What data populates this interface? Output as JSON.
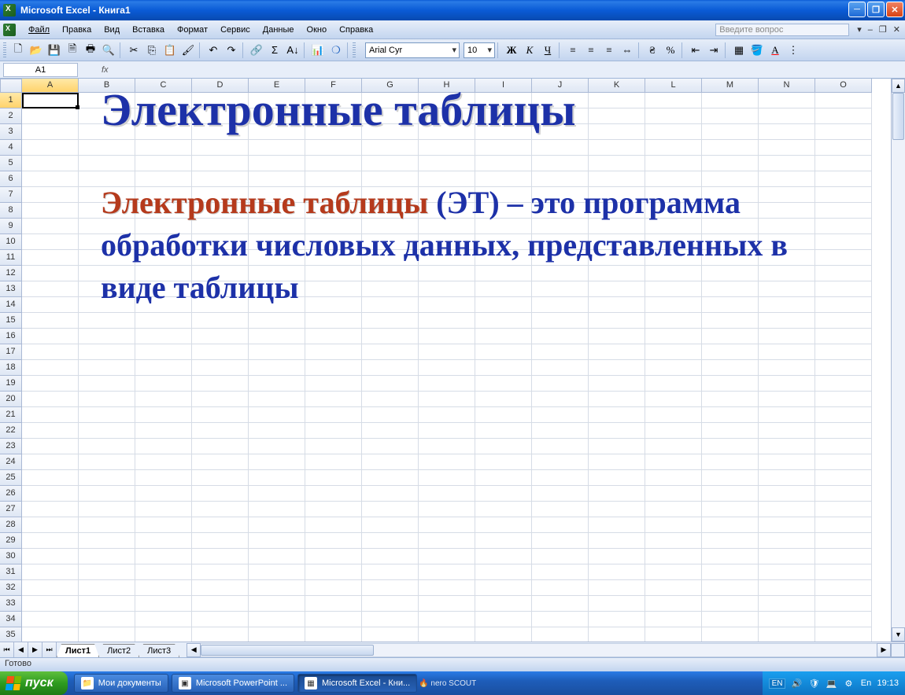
{
  "titlebar": {
    "title": "Microsoft Excel - Книга1"
  },
  "menubar": {
    "items": [
      "Файл",
      "Правка",
      "Вид",
      "Вставка",
      "Формат",
      "Сервис",
      "Данные",
      "Окно",
      "Справка"
    ],
    "question_placeholder": "Введите вопрос"
  },
  "toolbar": {
    "font_name": "Arial Cyr",
    "font_size": "10",
    "bold": "Ж",
    "italic": "К",
    "underline": "Ч",
    "currency": "%"
  },
  "formula": {
    "cell_ref": "A1",
    "fx": "fx",
    "value": ""
  },
  "columns": [
    "A",
    "B",
    "C",
    "D",
    "E",
    "F",
    "G",
    "H",
    "I",
    "J",
    "K",
    "L",
    "M",
    "N",
    "O"
  ],
  "row_count": 35,
  "sheet_tabs": [
    "Лист1",
    "Лист2",
    "Лист3"
  ],
  "active_tab": 0,
  "statusbar": {
    "text": "Готово"
  },
  "overlay": {
    "title": "Электронные таблицы",
    "body_red": "Электронные таблицы",
    "body_rest": " (ЭТ) – это программа обработки числовых данных, представленных в виде таблицы"
  },
  "taskbar": {
    "start": "пуск",
    "items": [
      {
        "label": "Мои документы",
        "icon": "📁"
      },
      {
        "label": "Microsoft PowerPoint ...",
        "icon": "▣"
      },
      {
        "label": "Microsoft Excel - Кни...",
        "icon": "▦",
        "active": true
      }
    ],
    "lang": "EN",
    "nero": "nero SCOUT",
    "clock": "19:13"
  }
}
